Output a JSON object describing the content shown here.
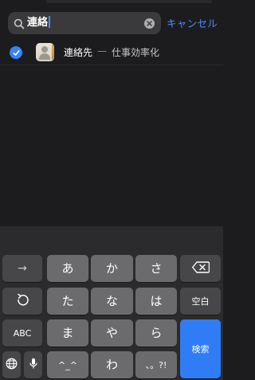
{
  "search": {
    "query": "連絡",
    "cancel_label": "キャンセル"
  },
  "result": {
    "title": "連絡先",
    "separator": "—",
    "subtitle": "仕事効率化",
    "checked": true
  },
  "keyboard": {
    "row1": {
      "arrow": "→",
      "a": "あ",
      "ka": "か",
      "sa": "さ",
      "delete_icon": "backspace-icon"
    },
    "row2": {
      "undo_icon": "undo-icon",
      "ta": "た",
      "na": "な",
      "ha": "は",
      "space": "空白"
    },
    "row3": {
      "abc": "ABC",
      "ma": "ま",
      "ya": "や",
      "ra": "ら",
      "search": "検索"
    },
    "row4": {
      "globe_icon": "globe-icon",
      "mic_icon": "microphone-icon",
      "emoticon": "^_^",
      "wa": "わ",
      "punct": "、。?!"
    }
  },
  "colors": {
    "accent": "#4b8dff",
    "return_key": "#2f7cf6"
  }
}
